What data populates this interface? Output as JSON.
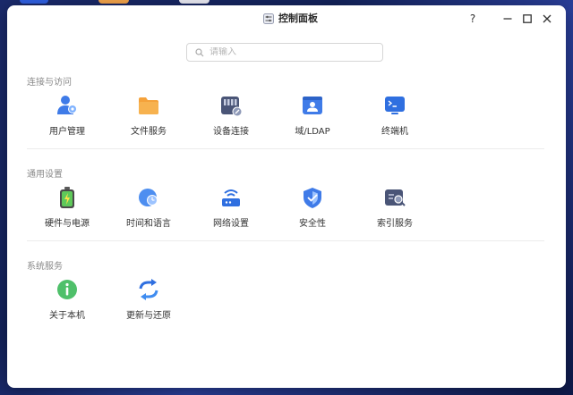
{
  "window": {
    "title": "控制面板"
  },
  "titlebar": {
    "help": "?",
    "minimize": "–",
    "maximize": "☐",
    "close": "✕"
  },
  "search": {
    "placeholder": "请输入"
  },
  "sections": [
    {
      "title": "连接与访问",
      "items": [
        {
          "label": "用户管理",
          "icon": "user-management-icon"
        },
        {
          "label": "文件服务",
          "icon": "folder-icon"
        },
        {
          "label": "设备连接",
          "icon": "device-connection-icon"
        },
        {
          "label": "域/LDAP",
          "icon": "domain-ldap-icon"
        },
        {
          "label": "终端机",
          "icon": "terminal-icon"
        }
      ]
    },
    {
      "title": "通用设置",
      "items": [
        {
          "label": "硬件与电源",
          "icon": "battery-icon"
        },
        {
          "label": "时间和语言",
          "icon": "clock-globe-icon"
        },
        {
          "label": "网络设置",
          "icon": "wifi-router-icon"
        },
        {
          "label": "安全性",
          "icon": "shield-icon"
        },
        {
          "label": "索引服务",
          "icon": "index-search-icon"
        }
      ]
    },
    {
      "title": "系统服务",
      "items": [
        {
          "label": "关于本机",
          "icon": "info-icon"
        },
        {
          "label": "更新与还原",
          "icon": "refresh-icon"
        }
      ]
    }
  ]
}
